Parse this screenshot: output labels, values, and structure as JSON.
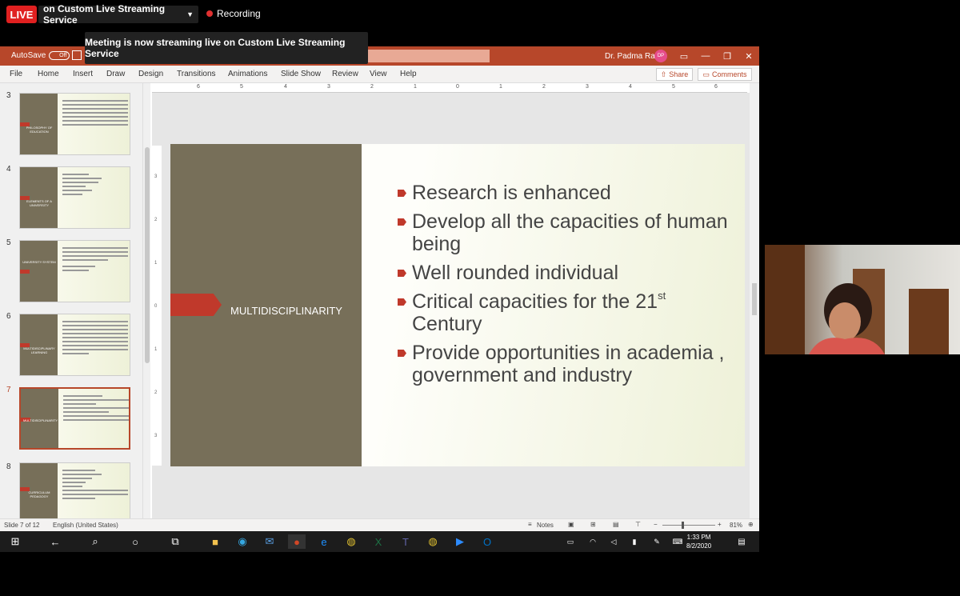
{
  "zoom": {
    "live_badge": "LIVE",
    "stream_service": "on Custom Live Streaming Service",
    "recording": "Recording",
    "tooltip": "Meeting is now streaming live on Custom Live Streaming Service"
  },
  "ppt": {
    "autosave_label": "AutoSave",
    "autosave_state": "Off",
    "user_name": "Dr. Padma Rani",
    "user_initials": "DP",
    "menu": [
      "File",
      "Home",
      "Insert",
      "Draw",
      "Design",
      "Transitions",
      "Animations",
      "Slide Show",
      "Review",
      "View",
      "Help"
    ],
    "share_label": "Share",
    "comments_label": "Comments",
    "ruler_h": [
      "6",
      "5",
      "4",
      "3",
      "2",
      "1",
      "0",
      "1",
      "2",
      "3",
      "4",
      "5",
      "6"
    ],
    "ruler_v": [
      "3",
      "2",
      "1",
      "0",
      "1",
      "2",
      "3"
    ],
    "thumbnails": [
      {
        "num": "3",
        "title": "PHILOSOPHY OF EDUCATION"
      },
      {
        "num": "4",
        "title": "ELEMENTS OF A UNIVERSITY"
      },
      {
        "num": "5",
        "title": "UNIVERSITY SYSTEM"
      },
      {
        "num": "6",
        "title": "MULTIDISCIPLINARY LEARNING"
      },
      {
        "num": "7",
        "title": "MULTIDISCIPLINARITY"
      },
      {
        "num": "8",
        "title": "CURRICULUM PEDAGOGY"
      }
    ],
    "slide": {
      "title": "MULTIDISCIPLINARITY",
      "bullets": [
        "Research is enhanced",
        "Develop all the capacities of human being",
        "Well rounded individual",
        "Critical capacities for the 21",
        "Provide opportunities in academia , government and industry"
      ],
      "bullet4_sup": "st",
      "bullet4_tail": "Century"
    },
    "status": {
      "slide_count": "Slide 7 of 12",
      "language": "English (United States)",
      "notes": "Notes",
      "zoom_level": "81%"
    }
  },
  "taskbar": {
    "time": "1:33 PM",
    "date": "8/2/2020"
  }
}
